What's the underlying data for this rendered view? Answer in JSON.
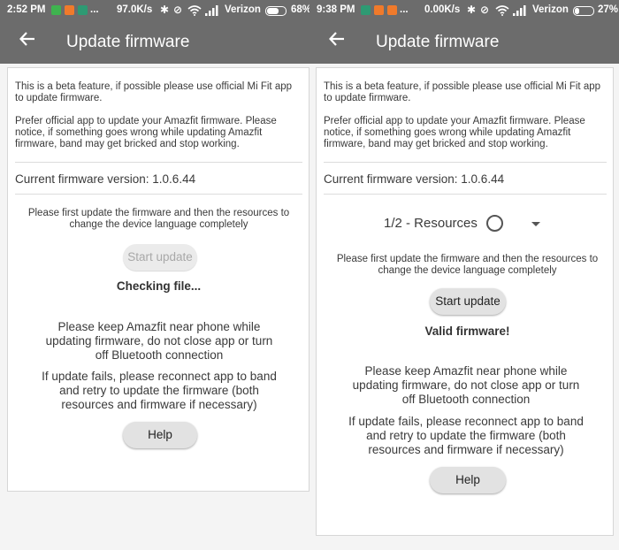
{
  "left": {
    "status": {
      "time": "2:52 PM",
      "speed": "97.0K/s",
      "dots": "...",
      "carrier": "Verizon",
      "battery": "68%",
      "battery_level": 0.68
    },
    "appbar": {
      "title": "Update firmware"
    },
    "beta_text": "This is a beta feature, if possible please use official Mi Fit app to update firmware.",
    "warning_text": "Prefer official app to update your Amazfit firmware. Please notice, if something goes wrong while updating Amazfit firmware, band may get bricked and stop working.",
    "current_version": "Current firmware version: 1.0.6.44",
    "first_update_text": "Please first update the firmware and then the resources to change the device language completely",
    "start_update_label": "Start update",
    "status_message": "Checking file...",
    "keep_near_text": "Please keep Amazfit near phone while updating firmware, do not close app or turn off Bluetooth connection",
    "if_fails_text": "If update fails, please reconnect app to band and retry to update the firmware (both resources and firmware if necessary)",
    "help_label": "Help"
  },
  "right": {
    "status": {
      "time": "9:38 PM",
      "speed": "0.00K/s",
      "dots": "...",
      "carrier": "Verizon",
      "battery": "27%",
      "battery_level": 0.27
    },
    "appbar": {
      "title": "Update firmware"
    },
    "beta_text": "This is a beta feature, if possible please use official Mi Fit app to update firmware.",
    "warning_text": "Prefer official app to update your Amazfit firmware. Please notice, if something goes wrong while updating Amazfit firmware, band may get bricked and stop working.",
    "current_version": "Current firmware version: 1.0.6.44",
    "spinner_value": "1/2 - Resources",
    "first_update_text": "Please first update the firmware and then the resources to change the device language completely",
    "start_update_label": "Start update",
    "status_message": "Valid firmware!",
    "keep_near_text": "Please keep Amazfit near phone while updating firmware, do not close app or turn off Bluetooth connection",
    "if_fails_text": "If update fails, please reconnect app to band and retry to update the firmware (both resources and firmware if necessary)",
    "help_label": "Help"
  },
  "colors": {
    "appbar": "#6c6c6c",
    "app_icon_green": "#3fb34f",
    "app_icon_orange": "#f07a2b",
    "app_icon_teal": "#2e9a73"
  },
  "icons": [
    "back-arrow-icon",
    "bluetooth-icon",
    "mute-icon",
    "wifi-icon",
    "signal-icon",
    "battery-icon",
    "radio-icon",
    "dropdown-arrow-icon"
  ]
}
